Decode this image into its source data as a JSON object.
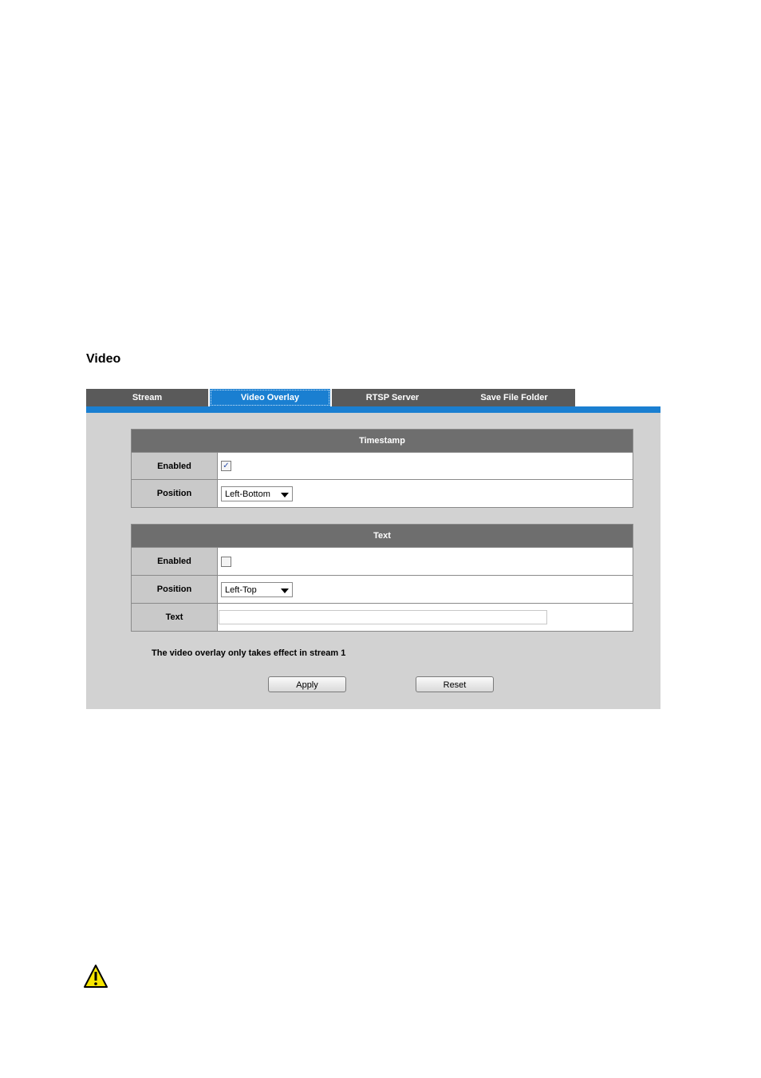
{
  "page": {
    "title": "Video"
  },
  "tabs": [
    {
      "label": "Stream",
      "active": false
    },
    {
      "label": "Video Overlay",
      "active": true
    },
    {
      "label": "RTSP Server",
      "active": false
    },
    {
      "label": "Save File Folder",
      "active": false
    }
  ],
  "timestamp": {
    "header": "Timestamp",
    "enabled_label": "Enabled",
    "enabled": true,
    "position_label": "Position",
    "position_value": "Left-Bottom"
  },
  "text_section": {
    "header": "Text",
    "enabled_label": "Enabled",
    "enabled": false,
    "position_label": "Position",
    "position_value": "Left-Top",
    "text_label": "Text",
    "text_value": ""
  },
  "note": "The video overlay only takes effect in stream 1",
  "buttons": {
    "apply": "Apply",
    "reset": "Reset"
  },
  "colors": {
    "accent": "#1a7fd1",
    "tab_dark": "#5a5a5a",
    "header_gray": "#6e6e6e",
    "panel_bg": "#d2d2d2"
  },
  "icons": {
    "warning": "warning-icon"
  }
}
